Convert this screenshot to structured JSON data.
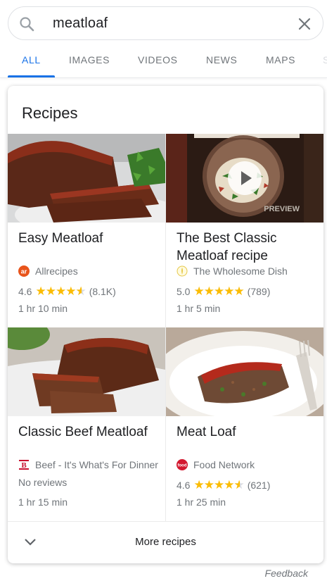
{
  "search": {
    "query": "meatloaf"
  },
  "tabs": [
    {
      "label": "ALL",
      "active": true
    },
    {
      "label": "IMAGES"
    },
    {
      "label": "VIDEOS"
    },
    {
      "label": "NEWS"
    },
    {
      "label": "MAPS"
    },
    {
      "label": "S"
    }
  ],
  "card": {
    "title": "Recipes",
    "more_label": "More recipes",
    "recipes": [
      {
        "name": "Easy Meatloaf",
        "source": "Allrecipes",
        "rating_value": "4.6",
        "stars": 4.6,
        "review_count": "(8.1K)",
        "time": "1 hr 10 min"
      },
      {
        "name": "The Best Classic Meatloaf recipe",
        "source": "The Wholesome Dish",
        "rating_value": "5.0",
        "stars": 5.0,
        "review_count": "(789)",
        "time": "1 hr 5 min",
        "overlay_text": "PREVIEW",
        "has_video": true
      },
      {
        "name": "Classic Beef Meatloaf",
        "source": "Beef - It's What's For Dinner",
        "rating_text": "No reviews",
        "time": "1 hr 15 min"
      },
      {
        "name": "Meat Loaf",
        "source": "Food Network",
        "rating_value": "4.6",
        "stars": 4.6,
        "review_count": "(621)",
        "time": "1 hr 25 min"
      }
    ]
  },
  "footer": {
    "feedback_label": "Feedback"
  },
  "colors": {
    "accent": "#1a73e8",
    "star": "#fbbc04",
    "muted": "#70757a"
  },
  "icons": [
    "search-icon",
    "close-icon",
    "chevron-down-icon",
    "play-icon",
    "allrecipes-logo",
    "wholesome-dish-logo",
    "beef-logo",
    "food-network-logo"
  ]
}
